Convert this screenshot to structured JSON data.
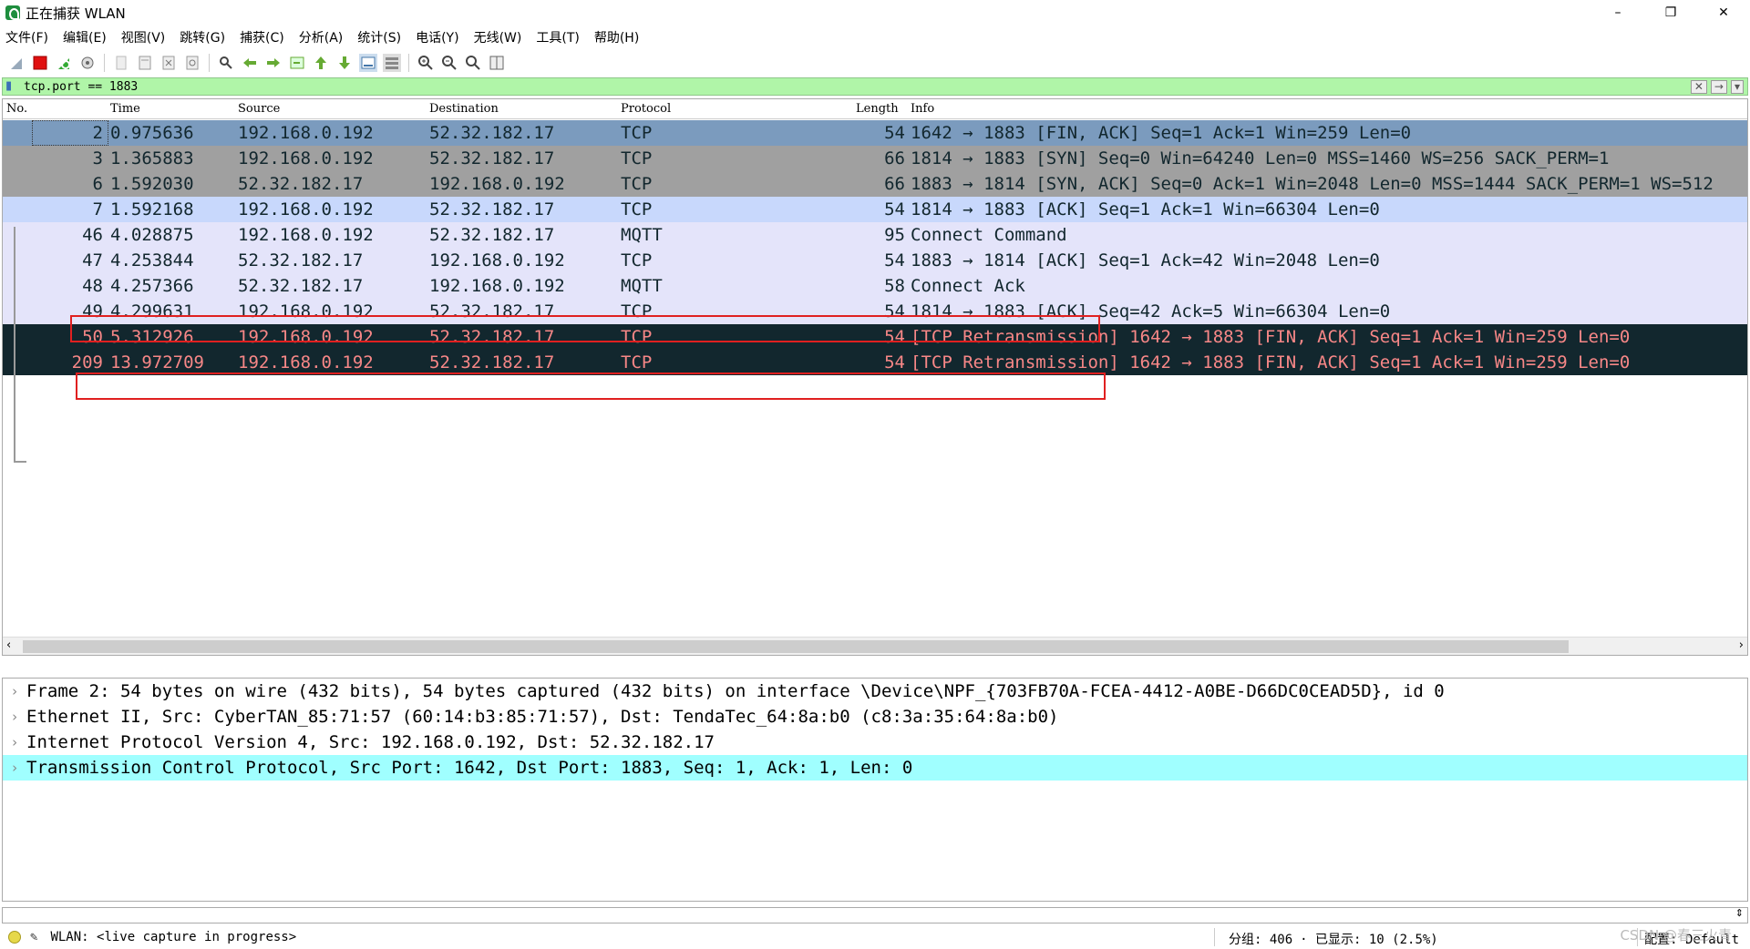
{
  "window": {
    "title": "正在捕获 WLAN",
    "minimize": "–",
    "restore": "❐",
    "close": "✕"
  },
  "menu": [
    "文件(F)",
    "编辑(E)",
    "视图(V)",
    "跳转(G)",
    "捕获(C)",
    "分析(A)",
    "统计(S)",
    "电话(Y)",
    "无线(W)",
    "工具(T)",
    "帮助(H)"
  ],
  "filter": {
    "value": "tcp.port == 1883",
    "clear": "✕",
    "apply": "→",
    "dropdown": "▾",
    "add": "+"
  },
  "columns": {
    "no": "No.",
    "time": "Time",
    "source": "Source",
    "destination": "Destination",
    "protocol": "Protocol",
    "length": "Length",
    "info": "Info"
  },
  "packets": [
    {
      "no": "2",
      "time": "0.975636",
      "src": "192.168.0.192",
      "dst": "52.32.182.17",
      "proto": "TCP",
      "len": "54",
      "info": "1642 → 1883 [FIN, ACK] Seq=1 Ack=1 Win=259 Len=0",
      "bg": "#7b9bbe",
      "fg": "#12272e"
    },
    {
      "no": "3",
      "time": "1.365883",
      "src": "192.168.0.192",
      "dst": "52.32.182.17",
      "proto": "TCP",
      "len": "66",
      "info": "1814 → 1883 [SYN] Seq=0 Win=64240 Len=0 MSS=1460 WS=256 SACK_PERM=1",
      "bg": "#a0a0a0",
      "fg": "#12272e"
    },
    {
      "no": "6",
      "time": "1.592030",
      "src": "52.32.182.17",
      "dst": "192.168.0.192",
      "proto": "TCP",
      "len": "66",
      "info": "1883 → 1814 [SYN, ACK] Seq=0 Ack=1 Win=2048 Len=0 MSS=1444 SACK_PERM=1 WS=512",
      "bg": "#a0a0a0",
      "fg": "#12272e"
    },
    {
      "no": "7",
      "time": "1.592168",
      "src": "192.168.0.192",
      "dst": "52.32.182.17",
      "proto": "TCP",
      "len": "54",
      "info": "1814 → 1883 [ACK] Seq=1 Ack=1 Win=66304 Len=0",
      "bg": "#c8d8fc",
      "fg": "#12272e"
    },
    {
      "no": "46",
      "time": "4.028875",
      "src": "192.168.0.192",
      "dst": "52.32.182.17",
      "proto": "MQTT",
      "len": "95",
      "info": "Connect Command",
      "bg": "#e4e4fa",
      "fg": "#12272e"
    },
    {
      "no": "47",
      "time": "4.253844",
      "src": "52.32.182.17",
      "dst": "192.168.0.192",
      "proto": "TCP",
      "len": "54",
      "info": "1883 → 1814 [ACK] Seq=1 Ack=42 Win=2048 Len=0",
      "bg": "#e4e4fa",
      "fg": "#12272e"
    },
    {
      "no": "48",
      "time": "4.257366",
      "src": "52.32.182.17",
      "dst": "192.168.0.192",
      "proto": "MQTT",
      "len": "58",
      "info": "Connect Ack",
      "bg": "#e4e4fa",
      "fg": "#12272e"
    },
    {
      "no": "49",
      "time": "4.299631",
      "src": "192.168.0.192",
      "dst": "52.32.182.17",
      "proto": "TCP",
      "len": "54",
      "info": "1814 → 1883 [ACK] Seq=42 Ack=5 Win=66304 Len=0",
      "bg": "#e4e4fa",
      "fg": "#12272e"
    },
    {
      "no": "50",
      "time": "5.312926",
      "src": "192.168.0.192",
      "dst": "52.32.182.17",
      "proto": "TCP",
      "len": "54",
      "info": "[TCP Retransmission] 1642 → 1883 [FIN, ACK] Seq=1 Ack=1 Win=259 Len=0",
      "bg": "#12272e",
      "fg": "#f78787"
    },
    {
      "no": "209",
      "time": "13.972709",
      "src": "192.168.0.192",
      "dst": "52.32.182.17",
      "proto": "TCP",
      "len": "54",
      "info": "[TCP Retransmission] 1642 → 1883 [FIN, ACK] Seq=1 Ack=1 Win=259 Len=0",
      "bg": "#12272e",
      "fg": "#f78787"
    }
  ],
  "details": [
    {
      "text": "Frame 2: 54 bytes on wire (432 bits), 54 bytes captured (432 bits) on interface \\Device\\NPF_{703FB70A-FCEA-4412-A0BE-D66DC0CEAD5D}, id 0",
      "selected": false
    },
    {
      "text": "Ethernet II, Src: CyberTAN_85:71:57 (60:14:b3:85:71:57), Dst: TendaTec_64:8a:b0 (c8:3a:35:64:8a:b0)",
      "selected": false
    },
    {
      "text": "Internet Protocol Version 4, Src: 192.168.0.192, Dst: 52.32.182.17",
      "selected": false
    },
    {
      "text": "Transmission Control Protocol, Src Port: 1642, Dst Port: 1883, Seq: 1, Ack: 1, Len: 0",
      "selected": true
    }
  ],
  "status": {
    "capture": "WLAN: <live capture in progress>",
    "packets": "分组: 406",
    "displayed": "· 已显示: 10 (2.5%)",
    "profile": "配置: Default",
    "watermark": "CSDN @春三火青"
  },
  "colors": {
    "filter_bg": "#b0f5a8",
    "selected_detail": "#a0ffff",
    "highlight_box": "#e02020"
  }
}
